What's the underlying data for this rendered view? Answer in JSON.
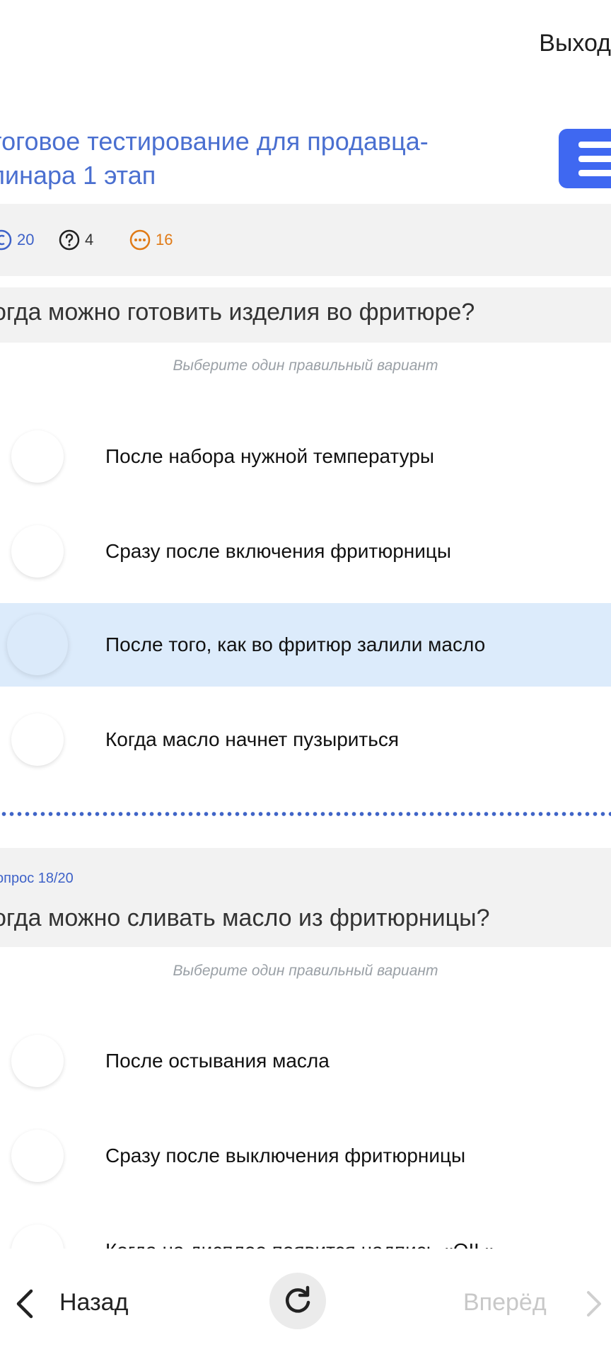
{
  "header": {
    "exit_label": "Выход",
    "title_line1": "тоговое тестирование для продавца-",
    "title_line2": "линара 1 этап"
  },
  "stats": {
    "answered": "20",
    "questions": "4",
    "remaining": "16",
    "colors": {
      "answered": "#3e62c8",
      "questions": "#333333",
      "remaining": "#e07a16"
    }
  },
  "question1": {
    "text": "огда можно готовить изделия во фритюре?",
    "hint": "Выберите один правильный вариант",
    "options": [
      {
        "label": "После набора нужной температуры"
      },
      {
        "label": "Сразу после включения фритюрницы"
      },
      {
        "label": "После того, как во фритюр залили масло"
      },
      {
        "label": "Когда масло начнет пузыриться"
      }
    ]
  },
  "question2": {
    "number": "опрос 18/20",
    "text": "огда можно сливать масло из фритюрницы?",
    "hint": "Выберите один правильный вариант",
    "options": [
      {
        "label": "После остывания масла"
      },
      {
        "label": "Сразу после выключения фритюрницы"
      },
      {
        "label": "Когда на дисплее появится надпись «OIL»"
      }
    ]
  },
  "nav": {
    "back_label": "Назад",
    "forward_label": "Вперёд"
  },
  "colors": {
    "accent": "#3f68f1",
    "selected": "#dcebfb"
  }
}
